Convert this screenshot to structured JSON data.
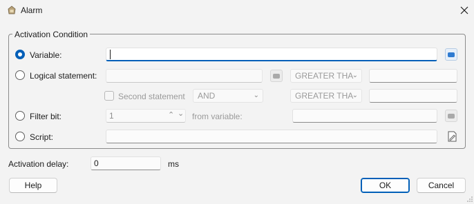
{
  "window": {
    "title": "Alarm"
  },
  "group": {
    "label": "Activation Condition"
  },
  "variable": {
    "label": "Variable:",
    "value": "",
    "selected": true
  },
  "logical": {
    "label": "Logical statement:",
    "value": "",
    "operator": "GREATER THA",
    "compare_value": ""
  },
  "second": {
    "label": "Second statement",
    "connector": "AND",
    "operator": "GREATER THA",
    "compare_value": ""
  },
  "filter": {
    "label": "Filter bit:",
    "bit_value": "1",
    "from_label": "from variable:",
    "variable_value": ""
  },
  "script": {
    "label": "Script:",
    "value": ""
  },
  "delay": {
    "label": "Activation delay:",
    "value": "0",
    "unit": "ms"
  },
  "buttons": {
    "help": "Help",
    "ok": "OK",
    "cancel": "Cancel"
  },
  "colors": {
    "accent": "#005fb8"
  }
}
